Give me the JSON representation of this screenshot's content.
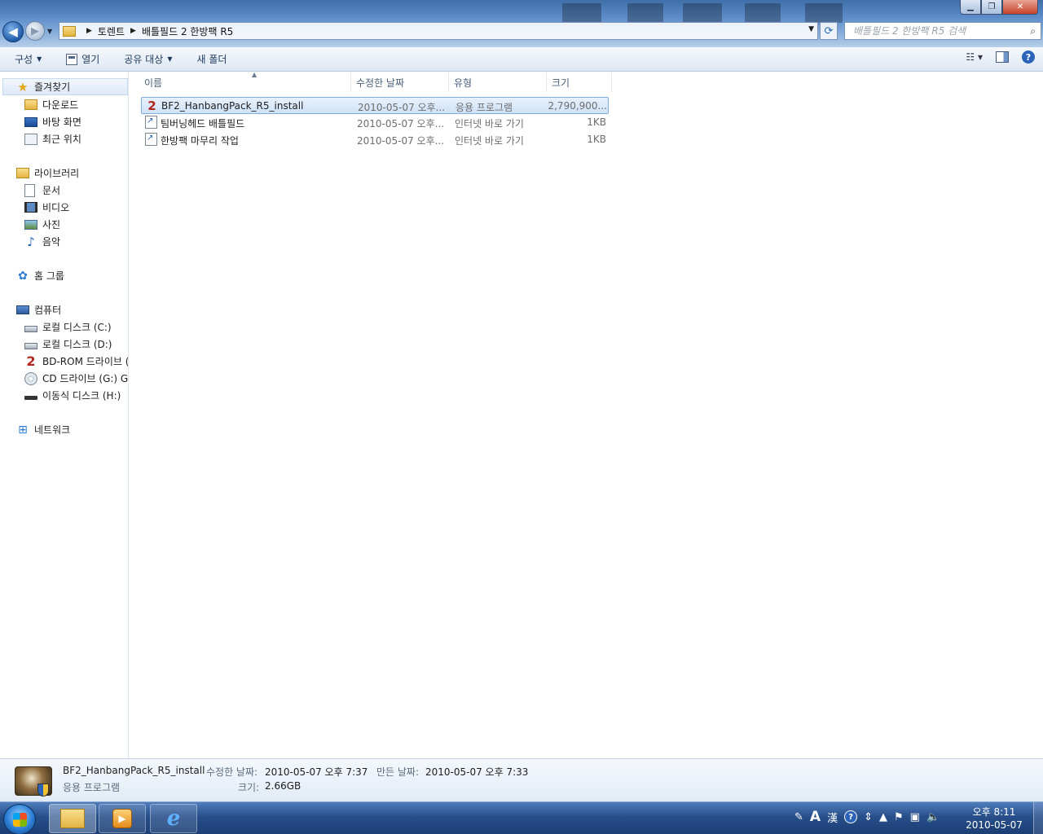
{
  "window": {
    "breadcrumbs": [
      "토렌트",
      "배틀필드 2 한방팩 R5"
    ],
    "search_placeholder": "배틀필드 2 한방팩 R5 검색"
  },
  "toolbar": {
    "organize": "구성",
    "open": "열기",
    "share": "공유 대상",
    "new_folder": "새 폴더"
  },
  "sidebar": {
    "favorites": {
      "label": "즐겨찾기",
      "items": [
        "다운로드",
        "바탕 화면",
        "최근 위치"
      ]
    },
    "libraries": {
      "label": "라이브러리",
      "items": [
        "문서",
        "비디오",
        "사진",
        "음악"
      ]
    },
    "homegroup": "홈 그룹",
    "computer": {
      "label": "컴퓨터",
      "items": [
        "로컬 디스크 (C:)",
        "로컬 디스크 (D:)",
        "BD-ROM 드라이브 (",
        "CD 드라이브 (G:) GI",
        "이동식 디스크 (H:)"
      ]
    },
    "network": "네트워크"
  },
  "columns": [
    "이름",
    "수정한 날짜",
    "유형",
    "크기"
  ],
  "files": [
    {
      "name": "BF2_HanbangPack_R5_install",
      "date": "2010-05-07 오후...",
      "type": "응용 프로그램",
      "size": "2,790,900...",
      "selected": true
    },
    {
      "name": "팀버닝헤드 배틀필드",
      "date": "2010-05-07 오후...",
      "type": "인터넷 바로 가기",
      "size": "1KB",
      "selected": false
    },
    {
      "name": "한방팩 마무리 작업",
      "date": "2010-05-07 오후...",
      "type": "인터넷 바로 가기",
      "size": "1KB",
      "selected": false
    }
  ],
  "details": {
    "name": "BF2_HanbangPack_R5_install",
    "type": "응용 프로그램",
    "modified_label": "수정한 날짜:",
    "modified_value": "2010-05-07 오후 7:37",
    "created_label": "만든 날짜:",
    "created_value": "2010-05-07 오후 7:33",
    "size_label": "크기:",
    "size_value": "2.66GB"
  },
  "taskbar": {
    "tray_lang": "A",
    "tray_hanja": "漢",
    "clock_time": "오후 8:11",
    "clock_date": "2010-05-07"
  },
  "colors": {
    "accent": "#2a63b8",
    "selection": "#cfe2f8",
    "taskbar": "#284f8a"
  }
}
